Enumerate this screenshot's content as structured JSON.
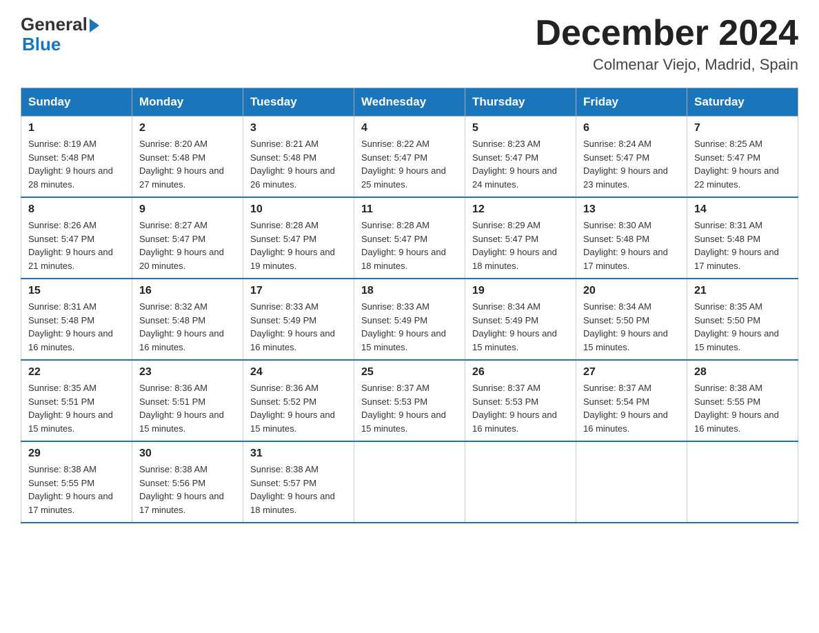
{
  "logo": {
    "general": "General",
    "blue": "Blue"
  },
  "title": "December 2024",
  "subtitle": "Colmenar Viejo, Madrid, Spain",
  "header_days": [
    "Sunday",
    "Monday",
    "Tuesday",
    "Wednesday",
    "Thursday",
    "Friday",
    "Saturday"
  ],
  "weeks": [
    [
      {
        "day": "1",
        "sunrise": "8:19 AM",
        "sunset": "5:48 PM",
        "daylight": "9 hours and 28 minutes."
      },
      {
        "day": "2",
        "sunrise": "8:20 AM",
        "sunset": "5:48 PM",
        "daylight": "9 hours and 27 minutes."
      },
      {
        "day": "3",
        "sunrise": "8:21 AM",
        "sunset": "5:48 PM",
        "daylight": "9 hours and 26 minutes."
      },
      {
        "day": "4",
        "sunrise": "8:22 AM",
        "sunset": "5:47 PM",
        "daylight": "9 hours and 25 minutes."
      },
      {
        "day": "5",
        "sunrise": "8:23 AM",
        "sunset": "5:47 PM",
        "daylight": "9 hours and 24 minutes."
      },
      {
        "day": "6",
        "sunrise": "8:24 AM",
        "sunset": "5:47 PM",
        "daylight": "9 hours and 23 minutes."
      },
      {
        "day": "7",
        "sunrise": "8:25 AM",
        "sunset": "5:47 PM",
        "daylight": "9 hours and 22 minutes."
      }
    ],
    [
      {
        "day": "8",
        "sunrise": "8:26 AM",
        "sunset": "5:47 PM",
        "daylight": "9 hours and 21 minutes."
      },
      {
        "day": "9",
        "sunrise": "8:27 AM",
        "sunset": "5:47 PM",
        "daylight": "9 hours and 20 minutes."
      },
      {
        "day": "10",
        "sunrise": "8:28 AM",
        "sunset": "5:47 PM",
        "daylight": "9 hours and 19 minutes."
      },
      {
        "day": "11",
        "sunrise": "8:28 AM",
        "sunset": "5:47 PM",
        "daylight": "9 hours and 18 minutes."
      },
      {
        "day": "12",
        "sunrise": "8:29 AM",
        "sunset": "5:47 PM",
        "daylight": "9 hours and 18 minutes."
      },
      {
        "day": "13",
        "sunrise": "8:30 AM",
        "sunset": "5:48 PM",
        "daylight": "9 hours and 17 minutes."
      },
      {
        "day": "14",
        "sunrise": "8:31 AM",
        "sunset": "5:48 PM",
        "daylight": "9 hours and 17 minutes."
      }
    ],
    [
      {
        "day": "15",
        "sunrise": "8:31 AM",
        "sunset": "5:48 PM",
        "daylight": "9 hours and 16 minutes."
      },
      {
        "day": "16",
        "sunrise": "8:32 AM",
        "sunset": "5:48 PM",
        "daylight": "9 hours and 16 minutes."
      },
      {
        "day": "17",
        "sunrise": "8:33 AM",
        "sunset": "5:49 PM",
        "daylight": "9 hours and 16 minutes."
      },
      {
        "day": "18",
        "sunrise": "8:33 AM",
        "sunset": "5:49 PM",
        "daylight": "9 hours and 15 minutes."
      },
      {
        "day": "19",
        "sunrise": "8:34 AM",
        "sunset": "5:49 PM",
        "daylight": "9 hours and 15 minutes."
      },
      {
        "day": "20",
        "sunrise": "8:34 AM",
        "sunset": "5:50 PM",
        "daylight": "9 hours and 15 minutes."
      },
      {
        "day": "21",
        "sunrise": "8:35 AM",
        "sunset": "5:50 PM",
        "daylight": "9 hours and 15 minutes."
      }
    ],
    [
      {
        "day": "22",
        "sunrise": "8:35 AM",
        "sunset": "5:51 PM",
        "daylight": "9 hours and 15 minutes."
      },
      {
        "day": "23",
        "sunrise": "8:36 AM",
        "sunset": "5:51 PM",
        "daylight": "9 hours and 15 minutes."
      },
      {
        "day": "24",
        "sunrise": "8:36 AM",
        "sunset": "5:52 PM",
        "daylight": "9 hours and 15 minutes."
      },
      {
        "day": "25",
        "sunrise": "8:37 AM",
        "sunset": "5:53 PM",
        "daylight": "9 hours and 15 minutes."
      },
      {
        "day": "26",
        "sunrise": "8:37 AM",
        "sunset": "5:53 PM",
        "daylight": "9 hours and 16 minutes."
      },
      {
        "day": "27",
        "sunrise": "8:37 AM",
        "sunset": "5:54 PM",
        "daylight": "9 hours and 16 minutes."
      },
      {
        "day": "28",
        "sunrise": "8:38 AM",
        "sunset": "5:55 PM",
        "daylight": "9 hours and 16 minutes."
      }
    ],
    [
      {
        "day": "29",
        "sunrise": "8:38 AM",
        "sunset": "5:55 PM",
        "daylight": "9 hours and 17 minutes."
      },
      {
        "day": "30",
        "sunrise": "8:38 AM",
        "sunset": "5:56 PM",
        "daylight": "9 hours and 17 minutes."
      },
      {
        "day": "31",
        "sunrise": "8:38 AM",
        "sunset": "5:57 PM",
        "daylight": "9 hours and 18 minutes."
      },
      null,
      null,
      null,
      null
    ]
  ],
  "labels": {
    "sunrise": "Sunrise: ",
    "sunset": "Sunset: ",
    "daylight": "Daylight: "
  }
}
